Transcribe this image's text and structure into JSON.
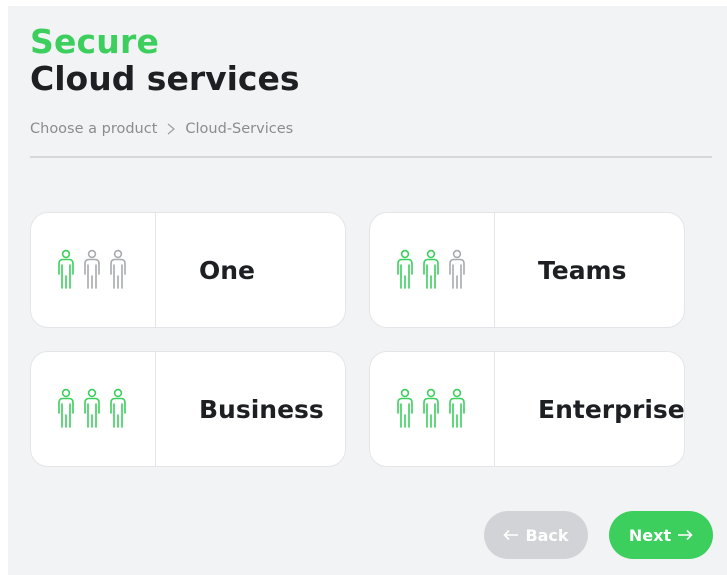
{
  "header": {
    "title_accent": "Secure",
    "title_main": "Cloud services"
  },
  "breadcrumb": {
    "items": [
      "Choose a product",
      "Cloud-Services"
    ]
  },
  "products": [
    {
      "label": "One",
      "active_users": 1,
      "total_users": 3
    },
    {
      "label": "Teams",
      "active_users": 2,
      "total_users": 3
    },
    {
      "label": "Business",
      "active_users": 3,
      "total_users": 3
    },
    {
      "label": "Enterprise",
      "active_users": 3,
      "total_users": 3
    }
  ],
  "nav": {
    "back_label": "Back",
    "next_label": "Next"
  },
  "icons": {
    "user": "person-icon",
    "breadcrumb_separator": "chevron-right-icon",
    "back": "arrow-left-icon",
    "next": "arrow-right-icon"
  },
  "colors": {
    "accent": "#3ccf5e",
    "inactive_icon": "#a8aaae",
    "text_dark": "#1e1f22",
    "muted": "#8a8c90",
    "back_button": "#d2d3d6"
  }
}
